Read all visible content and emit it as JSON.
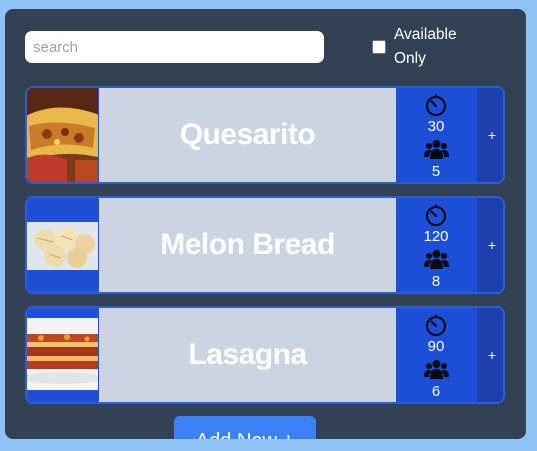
{
  "search": {
    "placeholder": "search",
    "value": ""
  },
  "filter": {
    "available_only_label": "Available Only",
    "checked": false
  },
  "recipes": [
    {
      "name": "Quesarito",
      "time": "30",
      "servings": "5",
      "add_label": "+"
    },
    {
      "name": "Melon Bread",
      "time": "120",
      "servings": "8",
      "add_label": "+"
    },
    {
      "name": "Lasagna",
      "time": "90",
      "servings": "6",
      "add_label": "+"
    }
  ],
  "add_new_label": "Add New +",
  "colors": {
    "page_bg": "#8fc3f6",
    "panel_bg": "#334155",
    "card_accent": "#1d4ed8",
    "name_area": "#cbd5e1",
    "add_button": "#3b82f6"
  }
}
